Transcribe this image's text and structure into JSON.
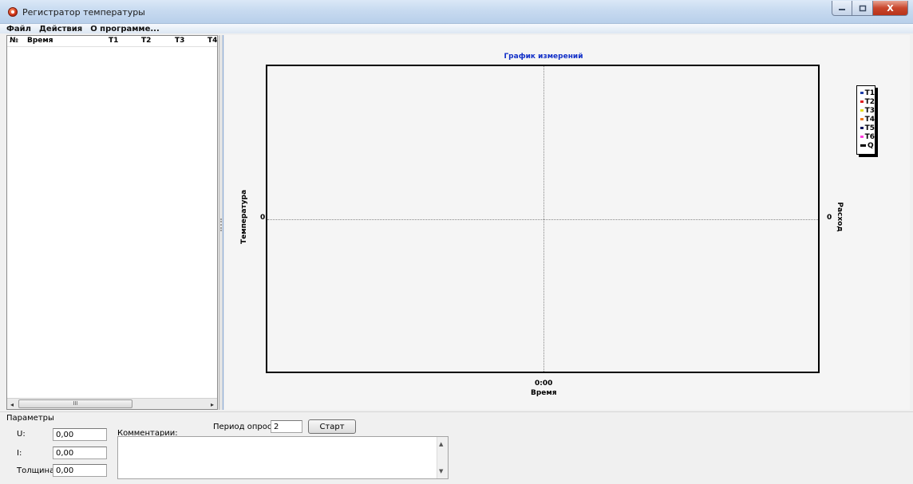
{
  "window": {
    "title": "Регистратор температуры",
    "min_icon": "minimize-icon",
    "max_icon": "maximize-icon",
    "close_label": "X"
  },
  "menu": [
    "Файл",
    "Действия",
    "О программе..."
  ],
  "table": {
    "columns": [
      "№",
      "Время",
      "T1",
      "T2",
      "T3",
      "T4"
    ],
    "scroll_thumb_label": "III",
    "scroll_left": "◂",
    "scroll_right": "▸"
  },
  "chart_data": {
    "type": "line",
    "title": "График измерений",
    "xlabel": "Время",
    "ylabel": "Температура",
    "y2label": "Расход",
    "x_ticks": [
      "0:00"
    ],
    "y_ticks": [
      "0"
    ],
    "y2_ticks": [
      "0"
    ],
    "grid": true,
    "legend_position": "right",
    "series": [
      {
        "name": "T1",
        "color": "#1f3fa8",
        "values": []
      },
      {
        "name": "T2",
        "color": "#e02020",
        "values": []
      },
      {
        "name": "T3",
        "color": "#e8e020",
        "values": []
      },
      {
        "name": "T4",
        "color": "#f07a1a",
        "values": []
      },
      {
        "name": "T5",
        "color": "#101860",
        "values": []
      },
      {
        "name": "T6",
        "color": "#ff40e0",
        "values": []
      },
      {
        "name": "Q",
        "color": "#000000",
        "values": []
      }
    ]
  },
  "params": {
    "group_label": "Параметры",
    "u_label": "U:",
    "u_value": "0,00",
    "i_label": "I:",
    "i_value": "0,00",
    "thickness_label": "Толщина:",
    "thickness_value": "0,00",
    "comments_label": "Комментарии:",
    "period_label": "Период опроса:",
    "period_value": "2",
    "start_label": "Старт"
  }
}
